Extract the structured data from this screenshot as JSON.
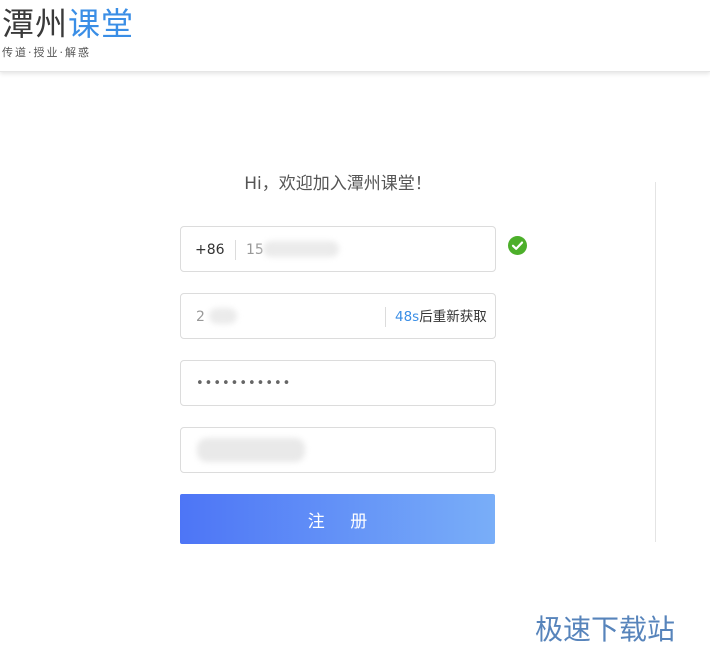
{
  "header": {
    "logo_part1": "潭州",
    "logo_part2": "课堂",
    "slogan": "传道·授业·解惑"
  },
  "form": {
    "welcome": "Hi，欢迎加入潭州课堂！",
    "phone": {
      "country_code": "+86",
      "value": "15"
    },
    "code": {
      "value": "2",
      "countdown": "48s",
      "resend_label": "后重新获取"
    },
    "password": {
      "value": "•••••••••••"
    },
    "register_label": "注 册"
  },
  "watermark": "极速下载站",
  "colors": {
    "brand_blue": "#3a8ee6",
    "verified_green": "#4caf2a",
    "button_gradient_start": "#4d75f6",
    "button_gradient_end": "#79aef8"
  },
  "icons": {
    "verified": "check-circle-icon"
  }
}
